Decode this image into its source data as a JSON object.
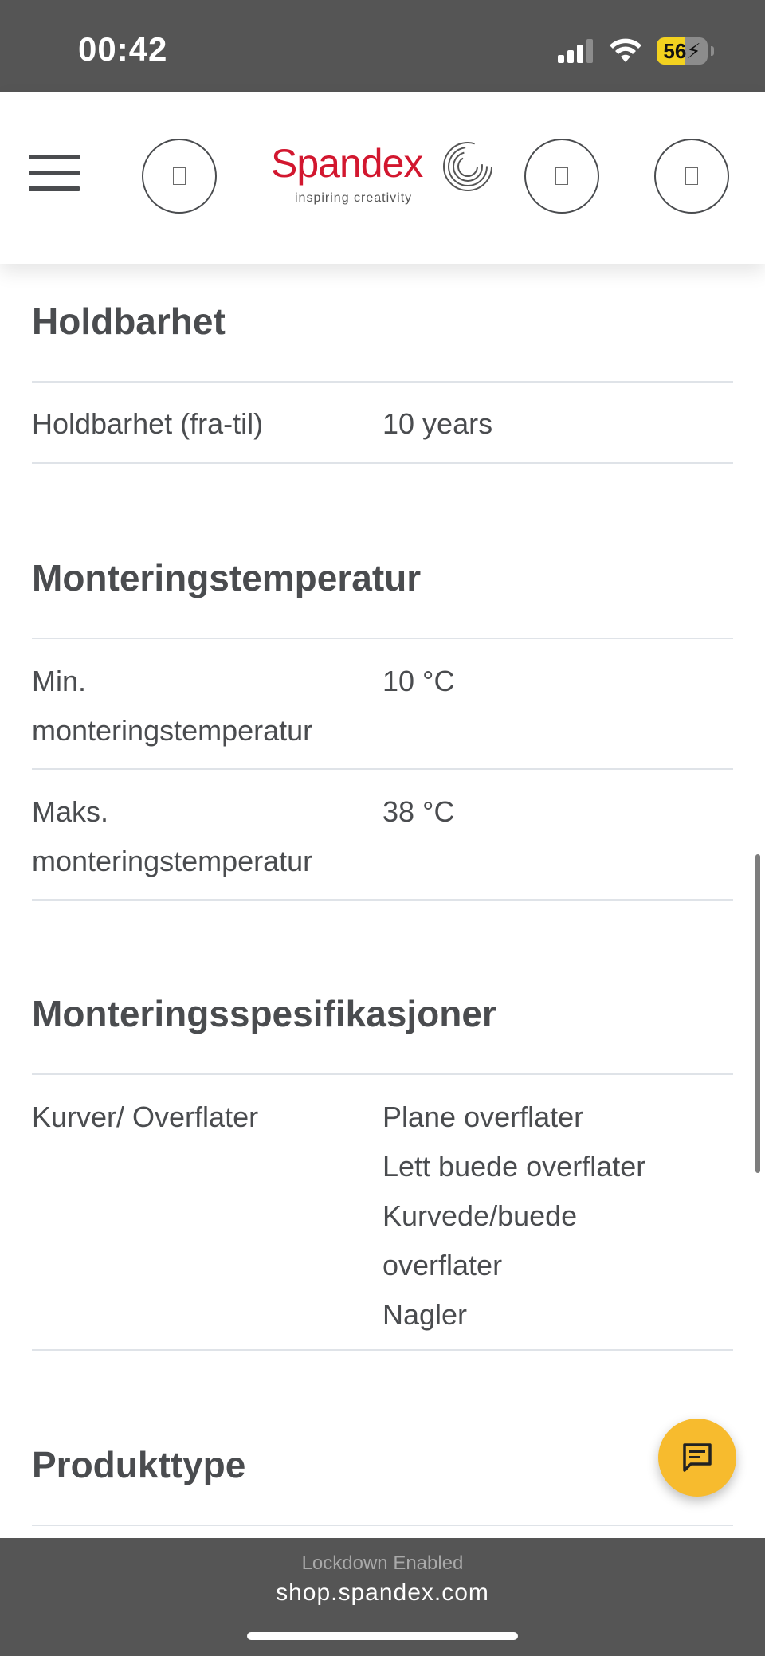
{
  "status_bar": {
    "time": "00:42",
    "battery_level": "56",
    "battery_fraction": 0.56,
    "battery_color": "#f3d21f",
    "icons": [
      "signal-icon",
      "wifi-icon",
      "battery-icon",
      "charging-bolt-icon"
    ]
  },
  "header": {
    "logo_text": "Spandex",
    "logo_tagline": "inspiring creativity",
    "brand_color": "#d2172f",
    "icons": [
      "hamburger-menu-icon",
      "search-icon",
      "account-icon",
      "cart-icon"
    ]
  },
  "sections": [
    {
      "title": "Holdbarhet",
      "rows": [
        {
          "label": "Holdbarhet (fra-til)",
          "values": [
            "10 years"
          ]
        }
      ]
    },
    {
      "title": "Monteringstemperatur",
      "rows": [
        {
          "label_lines": [
            "Min.",
            "monteringstemperatur"
          ],
          "values": [
            "10 °C"
          ]
        },
        {
          "label_lines": [
            "Maks.",
            "monteringstemperatur"
          ],
          "values": [
            "38 °C"
          ]
        }
      ]
    },
    {
      "title": "Monteringsspesifikasjoner",
      "rows": [
        {
          "label": "Kurver/ Overflater",
          "value_lines": [
            "Plane overflater",
            "Lett buede overflater",
            "Kurvede/buede",
            "overflater",
            "Nagler"
          ]
        }
      ]
    },
    {
      "title": "Produkttype",
      "rows": []
    }
  ],
  "chat_button": {
    "icon": "chat-icon",
    "color": "#f7bb2e"
  },
  "url_bar": {
    "lockdown_text": "Lockdown Enabled",
    "url": "shop.spandex.com"
  }
}
